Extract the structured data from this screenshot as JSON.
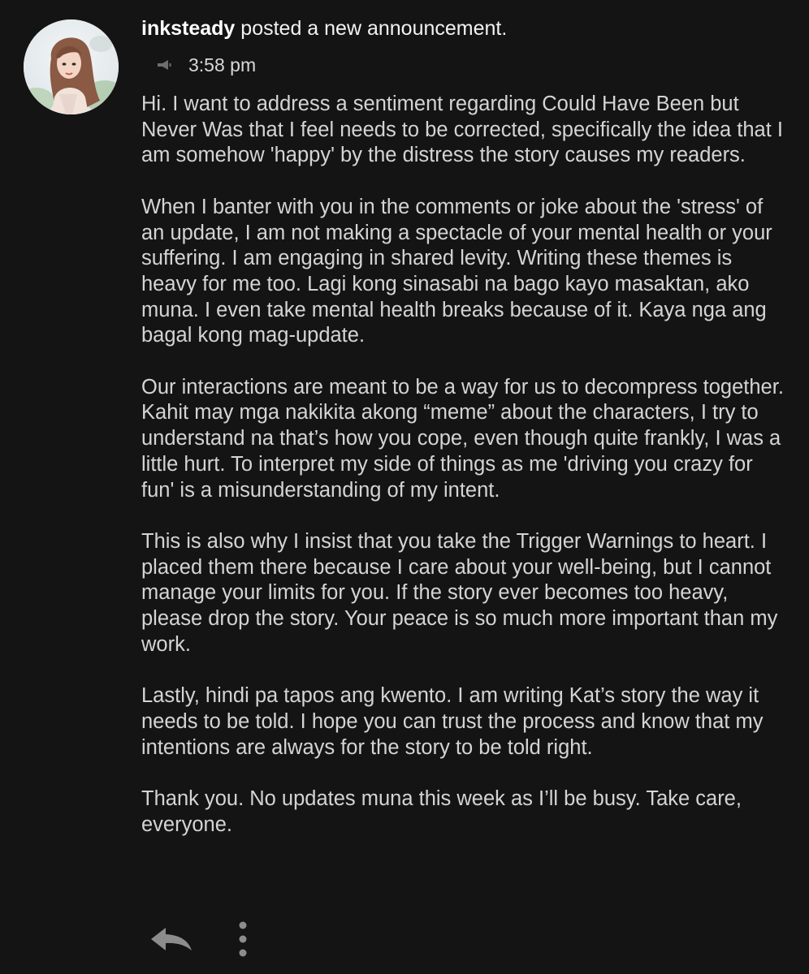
{
  "post": {
    "author": "inksteady",
    "action_text": " posted a new announcement.",
    "time": "3:58 pm",
    "time_icon": "megaphone-icon",
    "paragraphs": [
      "Hi. I want to address a sentiment regarding Could Have Been but Never Was that I feel needs to be corrected, specifically the idea that I am somehow 'happy' by the distress the story causes my readers.",
      "When I banter with you in the comments or joke about the 'stress' of an update, I am not making a spectacle of your mental health or your suffering. I am engaging in shared levity. Writing these themes is heavy for me too. Lagi kong sinasabi na bago kayo masaktan, ako muna. I even take mental health breaks because of it. Kaya nga ang bagal kong mag-update.",
      "Our interactions are meant to be a way for us to decompress together. Kahit may mga nakikita akong “meme” about the characters, I try to understand na that’s how you cope, even though quite frankly, I was a little hurt. To interpret my side of things as me 'driving you crazy for fun' is a misunderstanding of my intent.",
      "This is also why I insist that you take the Trigger Warnings to heart. I placed them there because I care about your well-being, but I cannot manage your limits for you. If the story ever becomes too heavy, please drop the story. Your peace is so much more important than my work.",
      "Lastly, hindi pa tapos ang kwento. I am writing Kat’s story the way it needs to be told. I hope you can trust the process and know that my intentions are always for the story to be told right.",
      "Thank you. No updates muna this week as I’ll be busy. Take care, everyone."
    ]
  },
  "actions": {
    "reply_icon": "reply-icon",
    "more_icon": "more-options-icon"
  },
  "colors": {
    "background": "#141414",
    "text": "#d4d4d4",
    "header_text": "#f2f2f2",
    "icon": "#8c8c8c"
  }
}
